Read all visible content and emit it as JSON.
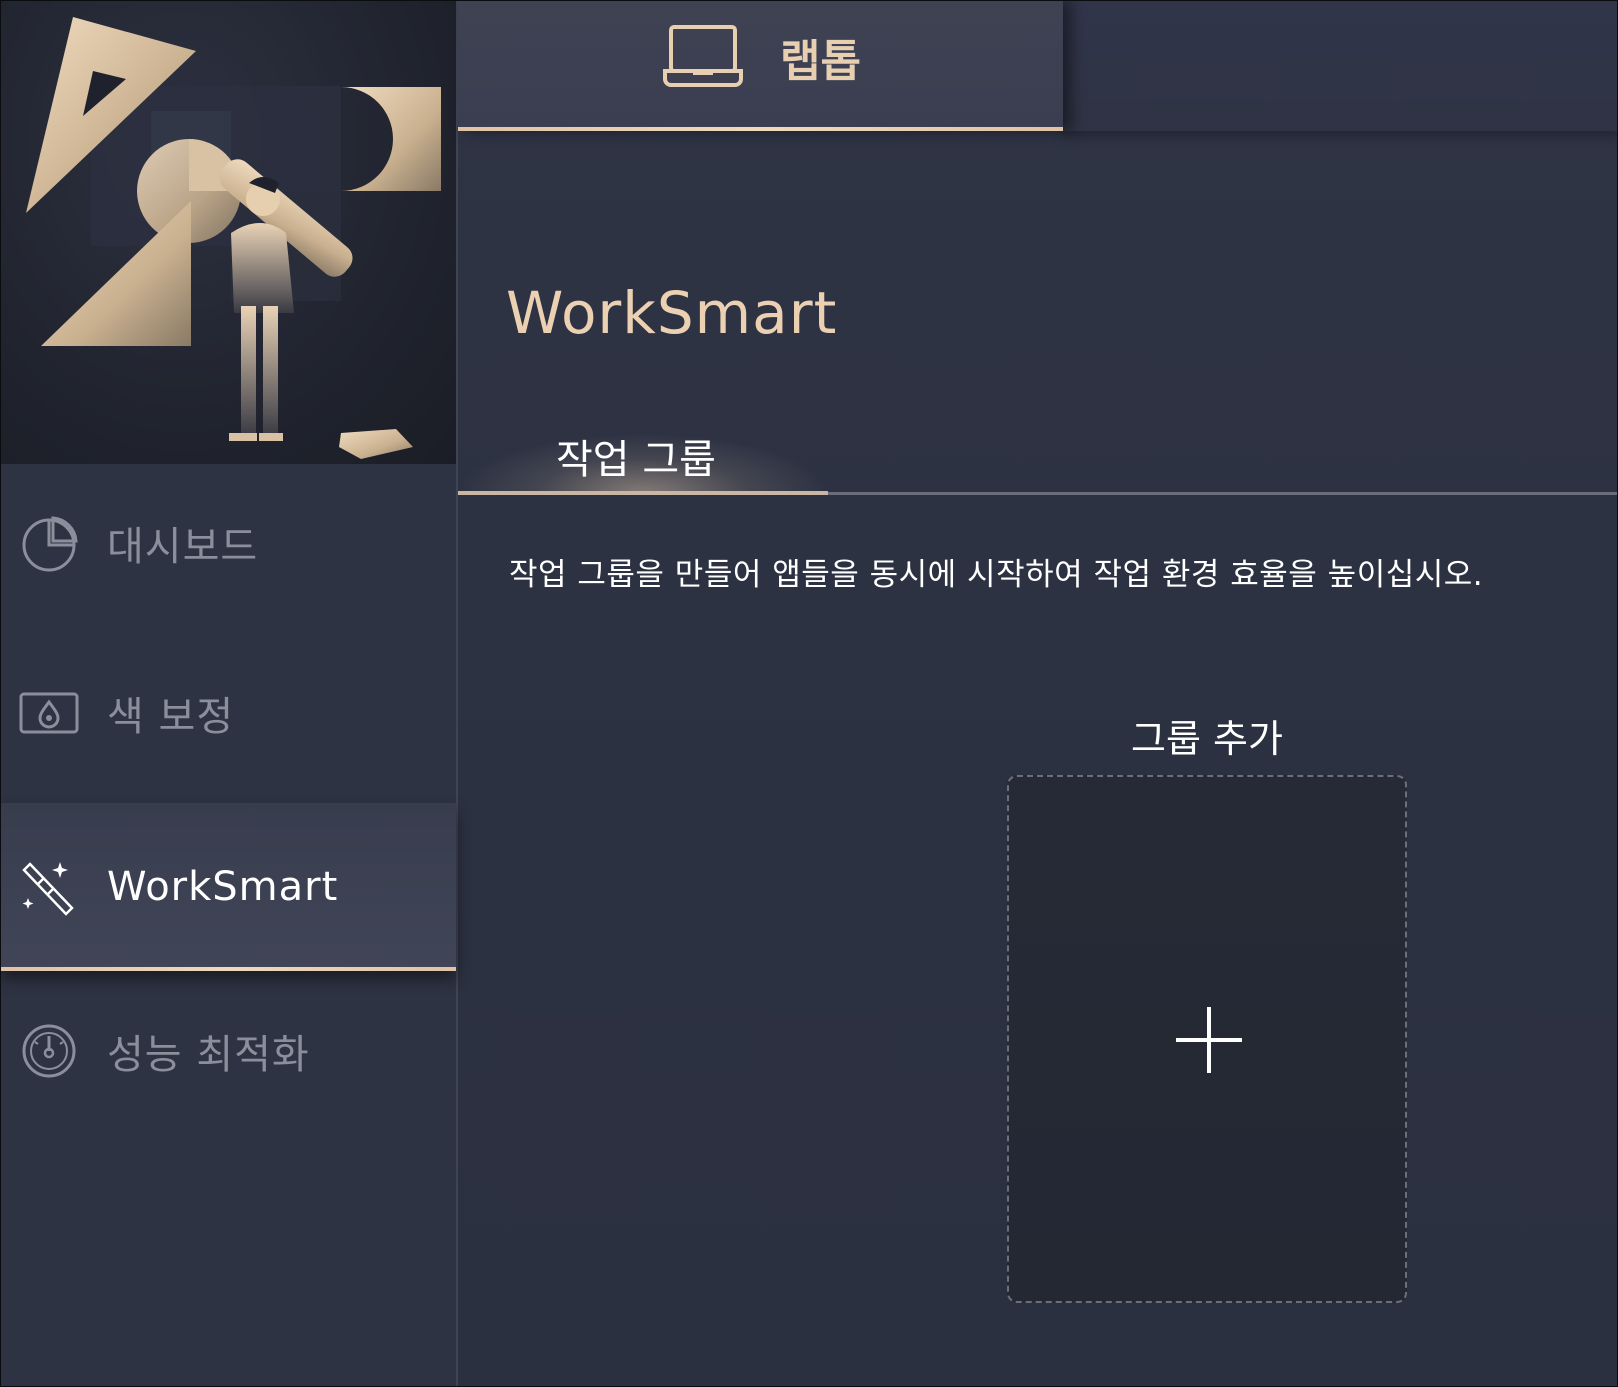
{
  "device_tab": {
    "icon": "laptop-icon",
    "label": "랩톱"
  },
  "sidebar": {
    "items": [
      {
        "icon": "pie-chart-icon",
        "label": "대시보드",
        "active": false
      },
      {
        "icon": "color-calibration-icon",
        "label": "색 보정",
        "active": false
      },
      {
        "icon": "magic-wand-icon",
        "label": "WorkSmart",
        "active": true
      },
      {
        "icon": "speedometer-icon",
        "label": "성능 최적화",
        "active": false
      }
    ]
  },
  "main": {
    "title": "WorkSmart",
    "tabs": [
      {
        "label": "작업 그룹",
        "active": true
      }
    ],
    "description": "작업 그룹을 만들어 앱들을 동시에 시작하여 작업 환경 효율을 높이십시오.",
    "add_group": {
      "label": "그룹 추가",
      "icon": "plus-icon"
    }
  },
  "colors": {
    "accent": "#e8cfb2",
    "background": "#2e3343",
    "active_item": "#3d4253"
  }
}
